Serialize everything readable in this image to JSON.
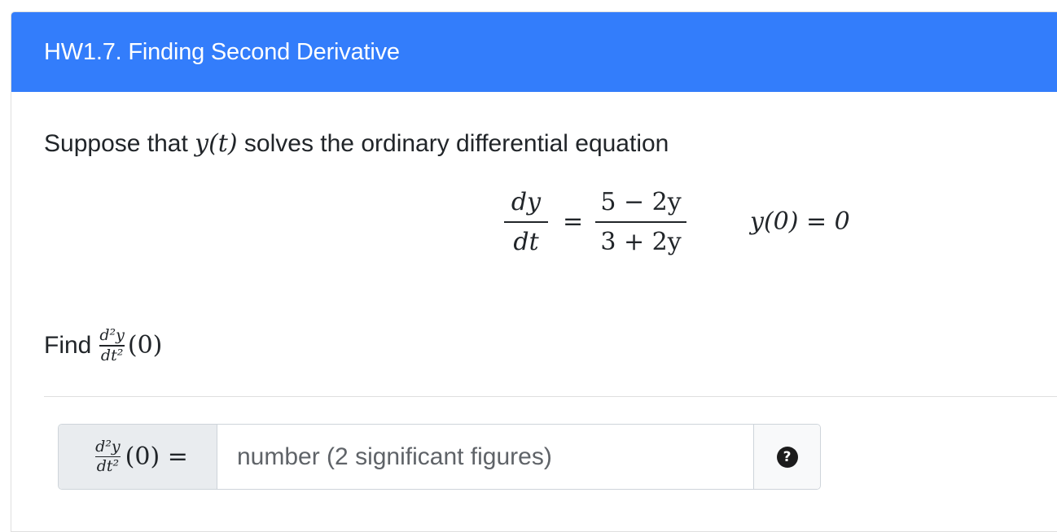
{
  "card": {
    "title": "HW1.7. Finding Second Derivative",
    "accent_color": "#337dfb"
  },
  "question": {
    "intro_text": "Suppose that",
    "intro_function": "y(t)",
    "intro_rest": "solves the ordinary differential equation",
    "equation": {
      "lhs_num": "dy",
      "lhs_den": "dt",
      "equals": "=",
      "rhs_num": "5 − 2y",
      "rhs_den": "3 + 2y",
      "initial_condition": "y(0) = 0"
    },
    "find_label": "Find",
    "find_num": "d²y",
    "find_den": "dt²",
    "find_arg": "(0)"
  },
  "answer": {
    "prepend_num": "d²y",
    "prepend_den": "dt²",
    "prepend_arg": "(0) =",
    "placeholder": "number (2 significant figures)",
    "value": "",
    "help_icon": "question-circle-icon",
    "help_glyph": "?"
  }
}
